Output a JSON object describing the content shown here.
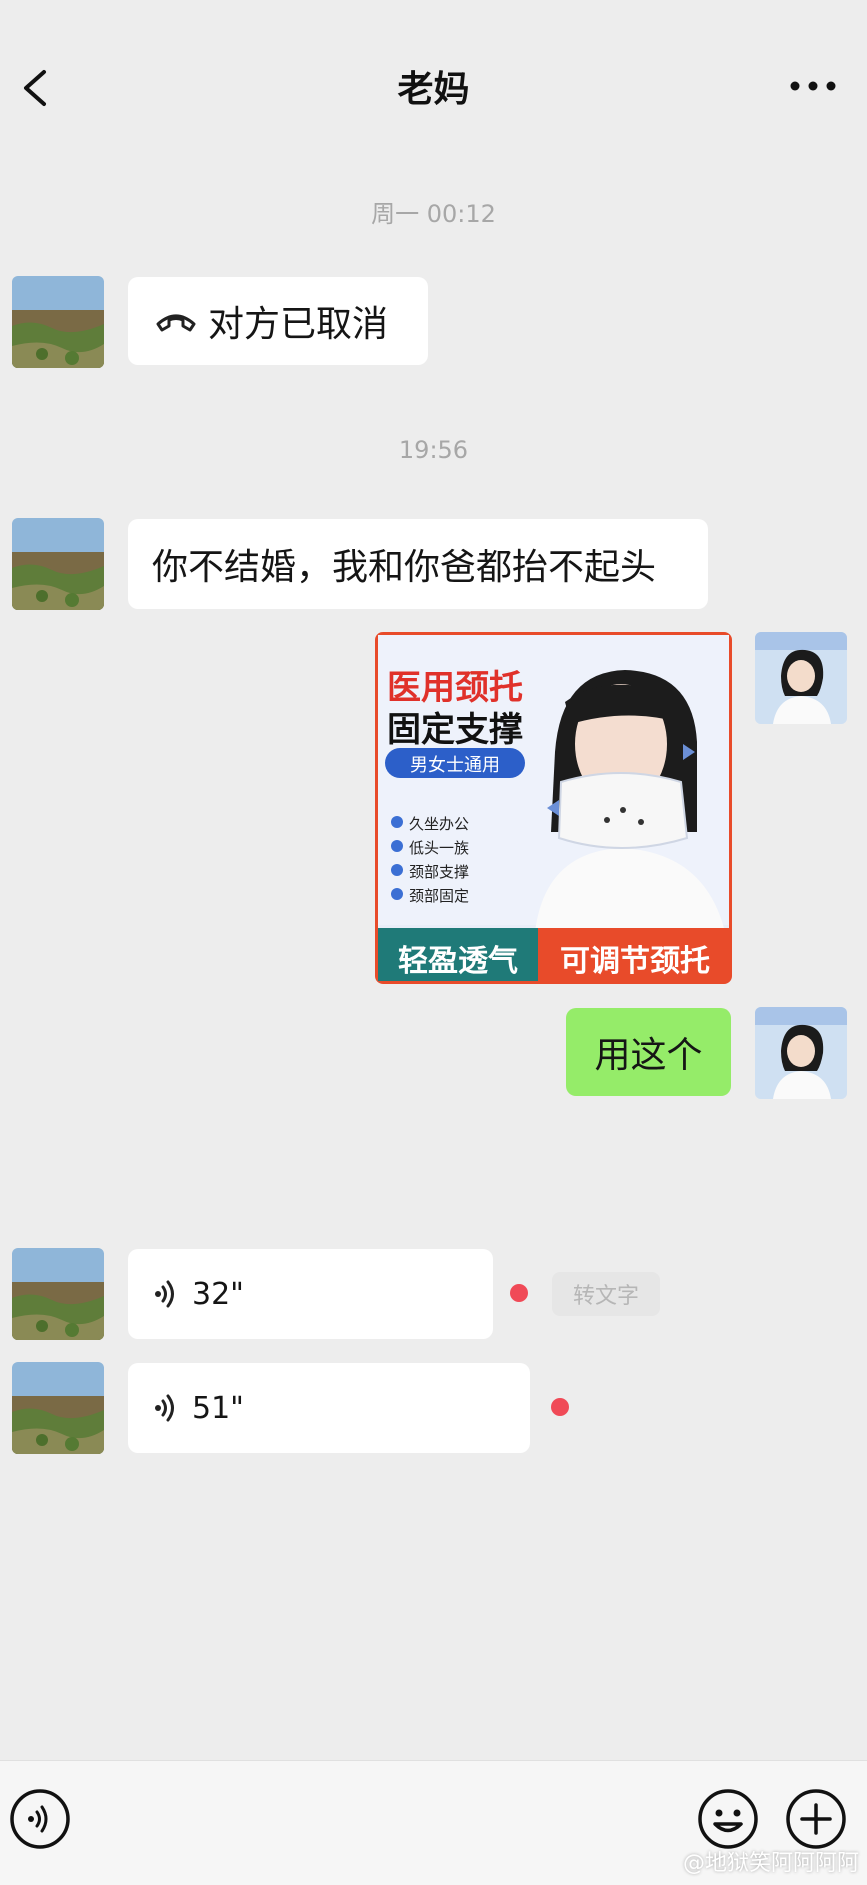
{
  "header": {
    "title": "老妈"
  },
  "messages": {
    "time_1": "周一 00:12",
    "call_status": "对方已取消",
    "time_2": "19:56",
    "mom_text": "你不结婚，我和你爸都抬不起头",
    "image_ad": {
      "title_line1": "医用颈托",
      "title_line2": "固定支撑",
      "badge": "男女士通用",
      "features": [
        "久坐办公",
        "低头一族",
        "颈部支撑",
        "颈部固定"
      ],
      "footer_left": "轻盈透气",
      "footer_right": "可调节颈托"
    },
    "my_text": "用这个",
    "voice_1": "32\"",
    "voice_2": "51\"",
    "to_text_label": "转文字"
  },
  "watermark": "@地狱笑阿阿阿阿",
  "colors": {
    "background": "#ededed",
    "my_bubble": "#95ec69",
    "unread_dot": "#f04a57"
  }
}
